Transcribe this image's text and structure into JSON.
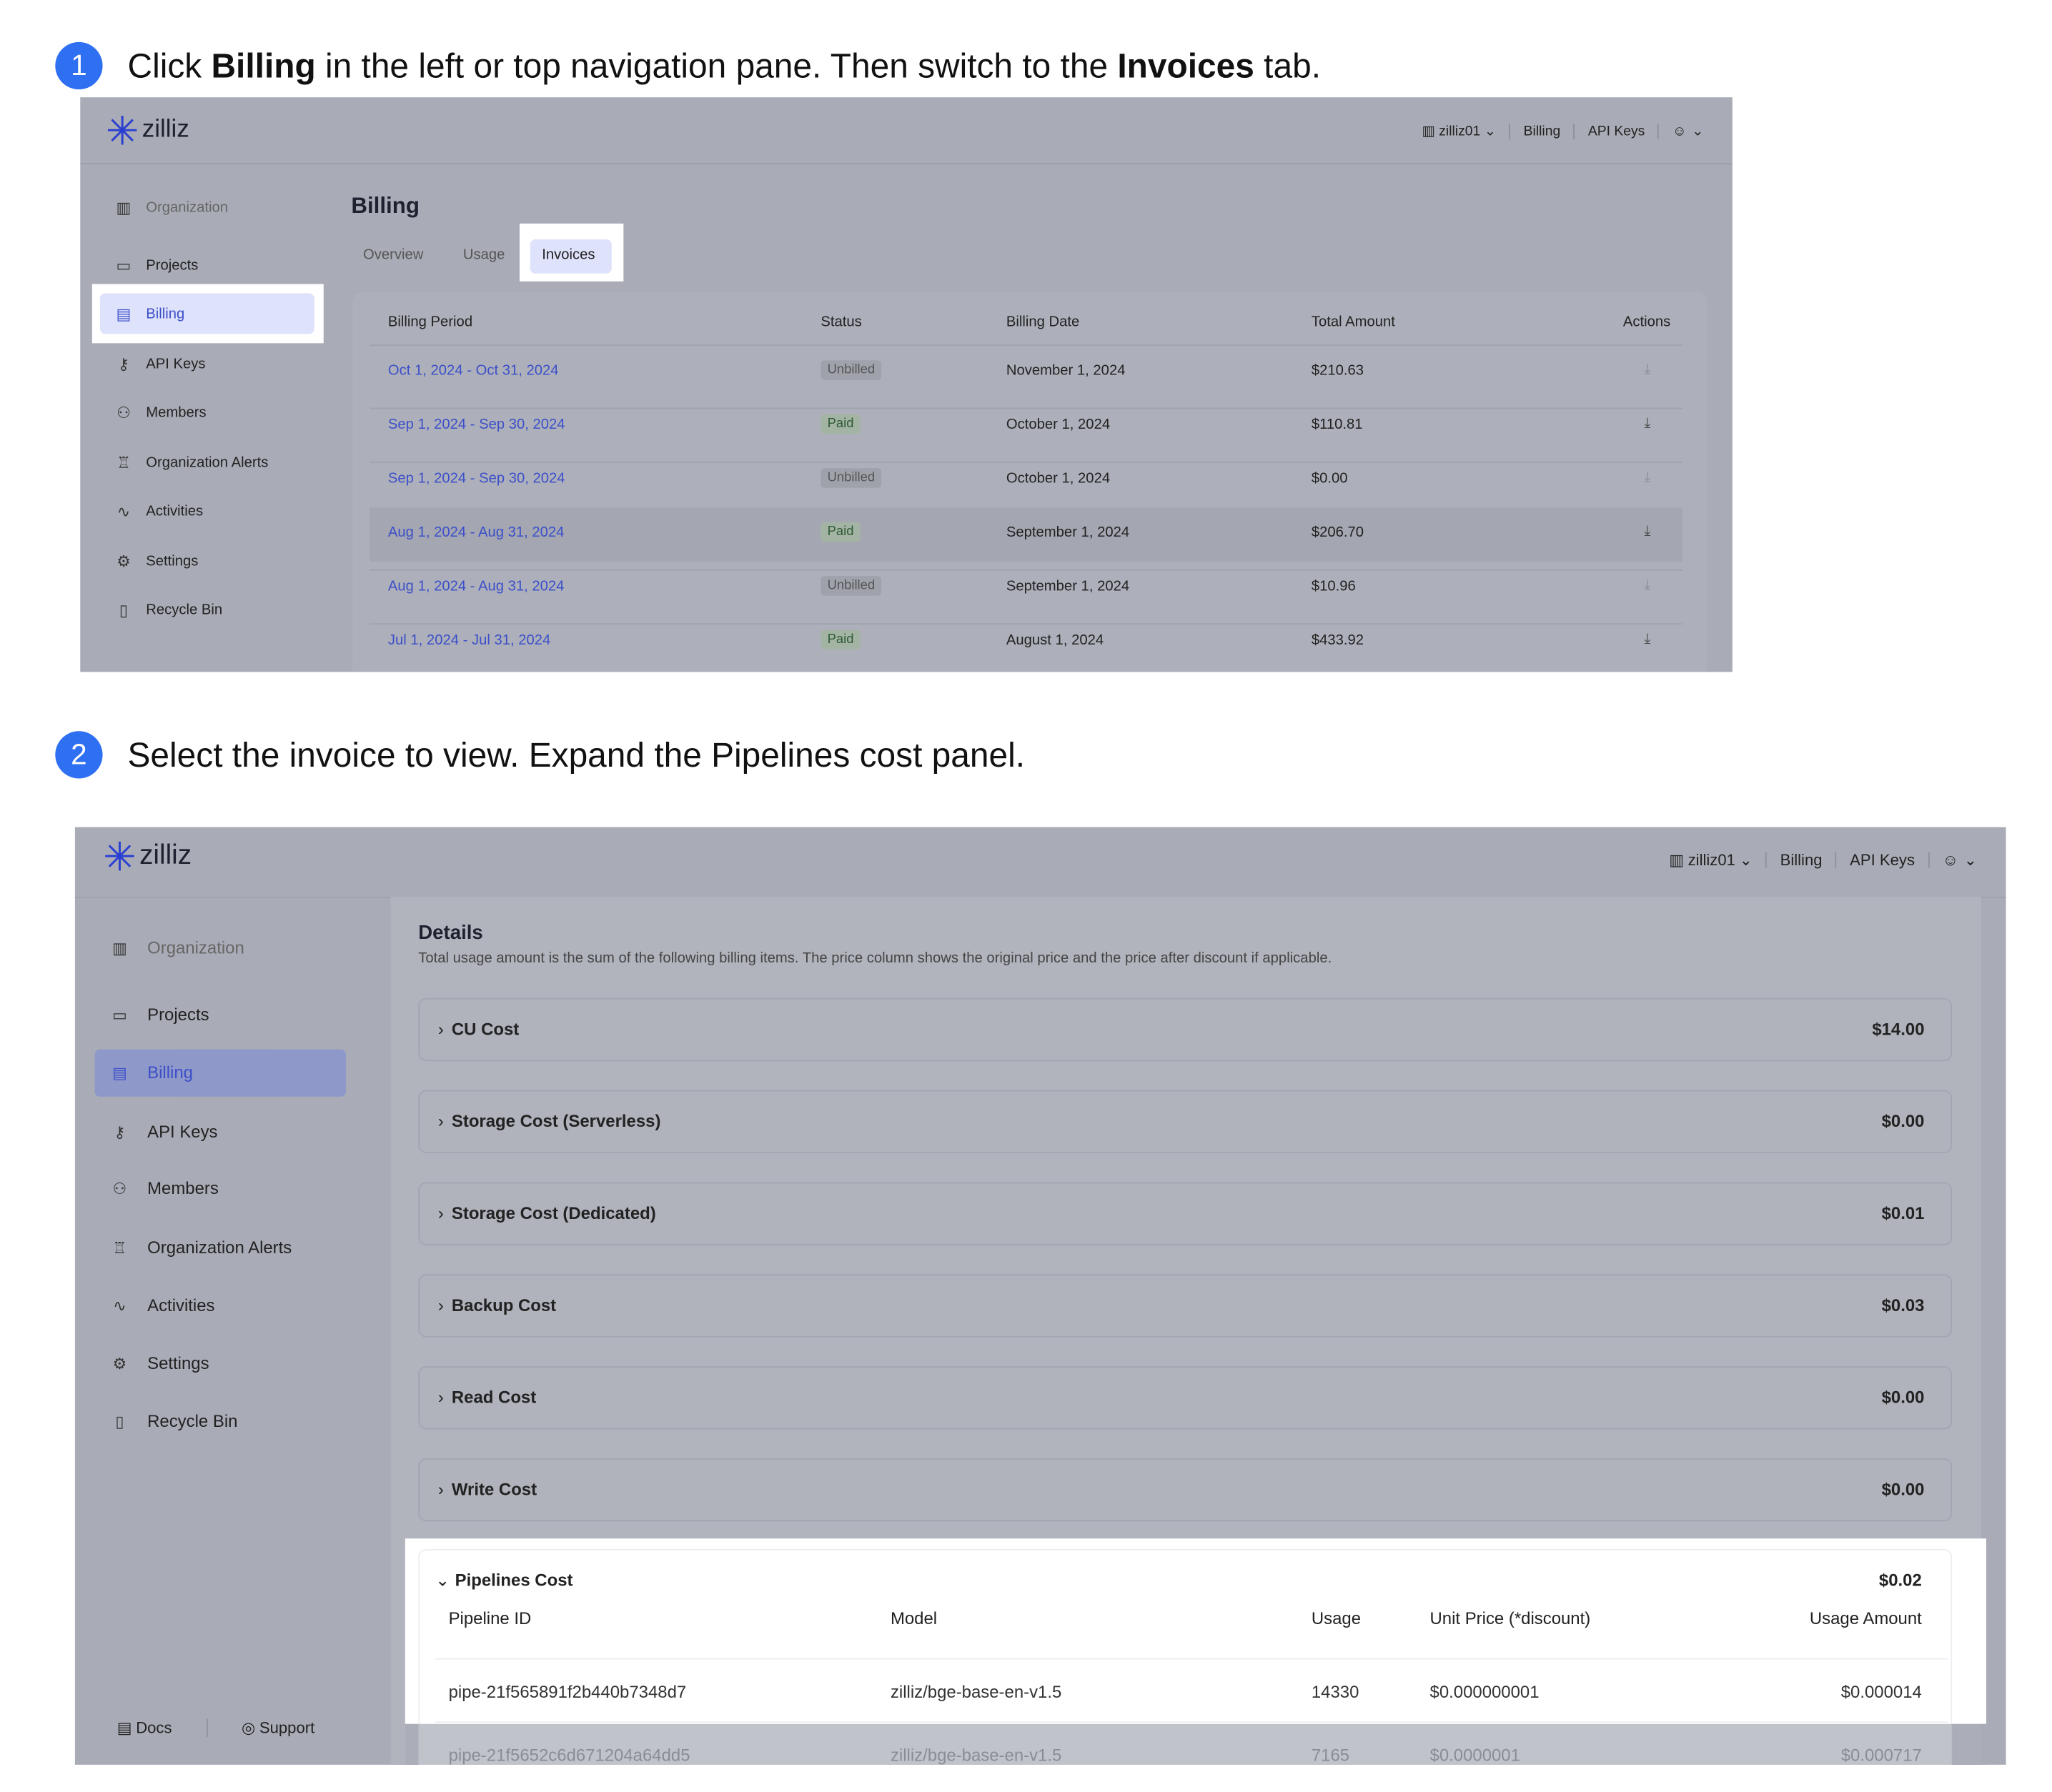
{
  "steps": [
    {
      "number": "1",
      "text_parts": [
        "Click ",
        "Billing",
        " in the left or top navigation pane. Then switch to the ",
        "Invoices",
        " tab."
      ]
    },
    {
      "number": "2",
      "text": "Select the invoice to view. Expand the Pipelines cost panel."
    }
  ],
  "brand": "zilliz",
  "topnav": {
    "org": "zilliz01",
    "billing": "Billing",
    "api_keys": "API Keys"
  },
  "sidebar": {
    "items": [
      "Organization",
      "Projects",
      "Billing",
      "API Keys",
      "Members",
      "Organization Alerts",
      "Activities",
      "Settings",
      "Recycle Bin"
    ],
    "active": "Billing",
    "footer": {
      "docs": "Docs",
      "support": "Support"
    }
  },
  "billing_page": {
    "title": "Billing",
    "tabs": [
      "Overview",
      "Usage",
      "Invoices"
    ],
    "active_tab": "Invoices",
    "columns": [
      "Billing Period",
      "Status",
      "Billing Date",
      "Total Amount",
      "Actions"
    ],
    "rows": [
      {
        "period": "Oct 1, 2024 - Oct 31, 2024",
        "status": "Unbilled",
        "date": "November 1, 2024",
        "amount": "$210.63"
      },
      {
        "period": "Sep 1, 2024 - Sep 30, 2024",
        "status": "Paid",
        "date": "October 1, 2024",
        "amount": "$110.81"
      },
      {
        "period": "Sep 1, 2024 - Sep 30, 2024",
        "status": "Unbilled",
        "date": "October 1, 2024",
        "amount": "$0.00"
      },
      {
        "period": "Aug 1, 2024 - Aug 31, 2024",
        "status": "Paid",
        "date": "September 1, 2024",
        "amount": "$206.70"
      },
      {
        "period": "Aug 1, 2024 - Aug 31, 2024",
        "status": "Unbilled",
        "date": "September 1, 2024",
        "amount": "$10.96"
      },
      {
        "period": "Jul 1, 2024 - Jul 31, 2024",
        "status": "Paid",
        "date": "August 1, 2024",
        "amount": "$433.92"
      }
    ]
  },
  "details": {
    "title": "Details",
    "description": "Total usage amount is the sum of the following billing items. The price column shows the original price and the price after discount if applicable.",
    "costs": [
      {
        "label": "CU Cost",
        "value": "$14.00"
      },
      {
        "label": "Storage Cost (Serverless)",
        "value": "$0.00"
      },
      {
        "label": "Storage Cost (Dedicated)",
        "value": "$0.01"
      },
      {
        "label": "Backup Cost",
        "value": "$0.03"
      },
      {
        "label": "Read Cost",
        "value": "$0.00"
      },
      {
        "label": "Write Cost",
        "value": "$0.00"
      }
    ],
    "pipelines": {
      "label": "Pipelines Cost",
      "value": "$0.02",
      "expanded": true,
      "columns": [
        "Pipeline ID",
        "Model",
        "Usage",
        "Unit Price (*discount)",
        "Usage Amount"
      ],
      "rows": [
        {
          "id": "pipe-21f565891f2b440b7348d7",
          "model": "zilliz/bge-base-en-v1.5",
          "usage": "14330",
          "unit_price": "$0.000000001",
          "amount": "$0.000014"
        },
        {
          "id": "pipe-21f5652c6d671204a64dd5",
          "model": "zilliz/bge-base-en-v1.5",
          "usage": "7165",
          "unit_price": "$0.0000001",
          "amount": "$0.000717"
        }
      ]
    }
  },
  "colors": {
    "accent": "#2f6ff2",
    "link": "#3c4fc9",
    "overlay": "#a9acb6",
    "active_nav": "#dfe2fb"
  }
}
